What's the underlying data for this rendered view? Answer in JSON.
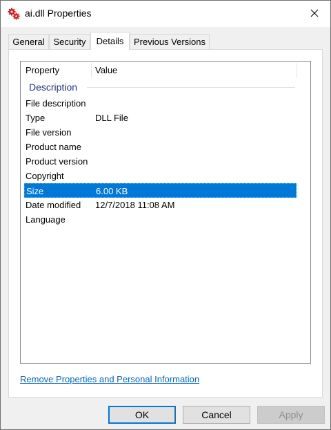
{
  "window": {
    "title": "ai.dll Properties",
    "icon": "gears-icon",
    "close_icon": "close-icon"
  },
  "tabs": [
    {
      "label": "General",
      "active": false
    },
    {
      "label": "Security",
      "active": false
    },
    {
      "label": "Details",
      "active": true
    },
    {
      "label": "Previous Versions",
      "active": false
    }
  ],
  "details": {
    "columns": {
      "property": "Property",
      "value": "Value"
    },
    "group": "Description",
    "rows": [
      {
        "property": "File description",
        "value": ""
      },
      {
        "property": "Type",
        "value": "DLL File"
      },
      {
        "property": "File version",
        "value": ""
      },
      {
        "property": "Product name",
        "value": ""
      },
      {
        "property": "Product version",
        "value": ""
      },
      {
        "property": "Copyright",
        "value": ""
      },
      {
        "property": "Size",
        "value": "6.00 KB",
        "selected": true
      },
      {
        "property": "Date modified",
        "value": "12/7/2018 11:08 AM"
      },
      {
        "property": "Language",
        "value": ""
      }
    ]
  },
  "link": "Remove Properties and Personal Information",
  "buttons": {
    "ok": "OK",
    "cancel": "Cancel",
    "apply": "Apply"
  },
  "colors": {
    "selection": "#0078d7",
    "link": "#0066cc",
    "group_label": "#1e3287"
  }
}
